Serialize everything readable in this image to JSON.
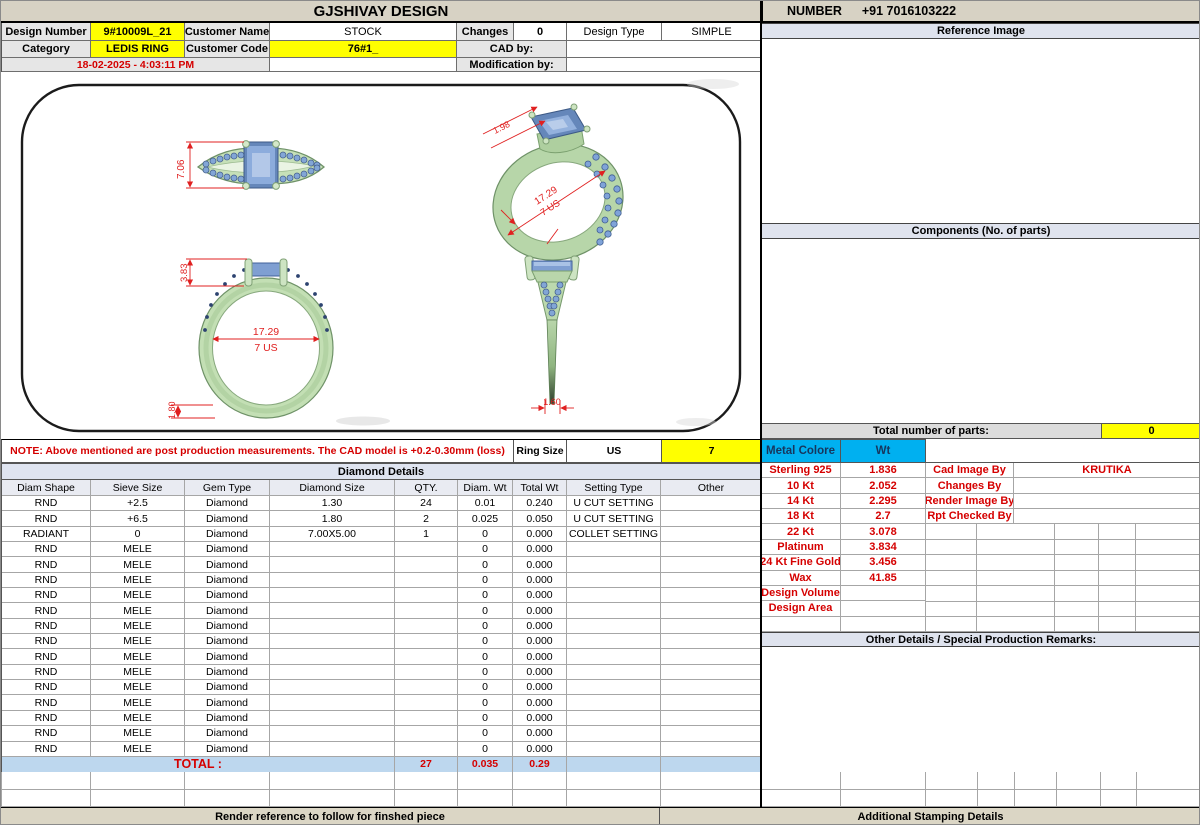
{
  "title": "GJSHIVAY DESIGN",
  "contact": {
    "label": "NUMBER",
    "phone": "+91 7016103222"
  },
  "header": {
    "design_number_label": "Design Number",
    "design_number_value": "9#10009L_21",
    "customer_name_label": "Customer Name",
    "customer_name_value": "STOCK",
    "changes_label": "Changes",
    "changes_value": "0",
    "design_type_label": "Design Type",
    "design_type_value": "SIMPLE",
    "category_label": "Category",
    "category_value": "LEDIS RING",
    "customer_code_label": "Customer Code",
    "customer_code_value": "76#1_",
    "cad_by_label": "CAD by:",
    "modification_by_label": "Modification by:",
    "datetime": "18-02-2025 - 4:03:11 PM"
  },
  "drawing": {
    "dim_top_width": "7.06",
    "dim_head": "1.98",
    "dim_diameter": "17.29",
    "dim_us_size": "7 US",
    "dim_head_height": "3.83",
    "dim_band_thickness": "1.80",
    "dim_band_width": "1.60"
  },
  "note_row": {
    "note": "NOTE: Above mentioned are post production measurements. The CAD model is +0.2-0.30mm (loss)",
    "ring_size_label": "Ring Size",
    "ring_size_unit": "US",
    "ring_size_value": "7"
  },
  "diamond_table": {
    "title": "Diamond Details",
    "columns": [
      "Diam Shape",
      "Sieve Size",
      "Gem Type",
      "Diamond Size",
      "QTY.",
      "Diam. Wt",
      "Total Wt",
      "Setting Type",
      "Other"
    ],
    "rows": [
      [
        "RND",
        "+2.5",
        "Diamond",
        "1.30",
        "24",
        "0.01",
        "0.240",
        "U CUT SETTING",
        ""
      ],
      [
        "RND",
        "+6.5",
        "Diamond",
        "1.80",
        "2",
        "0.025",
        "0.050",
        "U CUT SETTING",
        ""
      ],
      [
        "RADIANT",
        "0",
        "Diamond",
        "7.00X5.00",
        "1",
        "0",
        "0.000",
        "COLLET SETTING",
        ""
      ],
      [
        "RND",
        "MELE",
        "Diamond",
        "",
        "",
        "0",
        "0.000",
        "",
        ""
      ],
      [
        "RND",
        "MELE",
        "Diamond",
        "",
        "",
        "0",
        "0.000",
        "",
        ""
      ],
      [
        "RND",
        "MELE",
        "Diamond",
        "",
        "",
        "0",
        "0.000",
        "",
        ""
      ],
      [
        "RND",
        "MELE",
        "Diamond",
        "",
        "",
        "0",
        "0.000",
        "",
        ""
      ],
      [
        "RND",
        "MELE",
        "Diamond",
        "",
        "",
        "0",
        "0.000",
        "",
        ""
      ],
      [
        "RND",
        "MELE",
        "Diamond",
        "",
        "",
        "0",
        "0.000",
        "",
        ""
      ],
      [
        "RND",
        "MELE",
        "Diamond",
        "",
        "",
        "0",
        "0.000",
        "",
        ""
      ],
      [
        "RND",
        "MELE",
        "Diamond",
        "",
        "",
        "0",
        "0.000",
        "",
        ""
      ],
      [
        "RND",
        "MELE",
        "Diamond",
        "",
        "",
        "0",
        "0.000",
        "",
        ""
      ],
      [
        "RND",
        "MELE",
        "Diamond",
        "",
        "",
        "0",
        "0.000",
        "",
        ""
      ],
      [
        "RND",
        "MELE",
        "Diamond",
        "",
        "",
        "0",
        "0.000",
        "",
        ""
      ],
      [
        "RND",
        "MELE",
        "Diamond",
        "",
        "",
        "0",
        "0.000",
        "",
        ""
      ],
      [
        "RND",
        "MELE",
        "Diamond",
        "",
        "",
        "0",
        "0.000",
        "",
        ""
      ],
      [
        "RND",
        "MELE",
        "Diamond",
        "",
        "",
        "0",
        "0.000",
        "",
        ""
      ]
    ],
    "total_label": "TOTAL :",
    "totals": {
      "qty": "27",
      "diam_wt": "0.035",
      "total_wt": "0.29"
    }
  },
  "right_panel": {
    "reference_image_title": "Reference Image",
    "components_title": "Components (No. of parts)",
    "total_parts_label": "Total number of parts:",
    "total_parts_value": "0",
    "metal_columns": [
      "Metal Colore",
      "Wt"
    ],
    "metal_rows": [
      [
        "Sterling 925",
        "1.836"
      ],
      [
        "10 Kt",
        "2.052"
      ],
      [
        "14 Kt",
        "2.295"
      ],
      [
        "18 Kt",
        "2.7"
      ],
      [
        "22 Kt",
        "3.078"
      ],
      [
        "Platinum",
        "3.834"
      ],
      [
        "24 Kt Fine Gold",
        "3.456"
      ],
      [
        "Wax",
        "41.85"
      ],
      [
        "Design Volume",
        ""
      ],
      [
        "Design Area",
        ""
      ],
      [
        "",
        ""
      ]
    ],
    "credits": [
      [
        "Cad Image By",
        "KRUTIKA"
      ],
      [
        "Changes By",
        ""
      ],
      [
        "Render Image By",
        ""
      ],
      [
        "Rpt Checked By",
        ""
      ]
    ],
    "other_details_title": "Other Details / Special Production Remarks:"
  },
  "footer": {
    "left": "Render reference to follow for finshed piece",
    "right": "Additional Stamping Details"
  },
  "colors": {
    "accent_yellow": "#ffff00",
    "accent_cyan": "#00b0f0",
    "total_row_blue": "#bdd7ee",
    "header_tan": "#d7d2c4",
    "red_text": "#d50000"
  }
}
